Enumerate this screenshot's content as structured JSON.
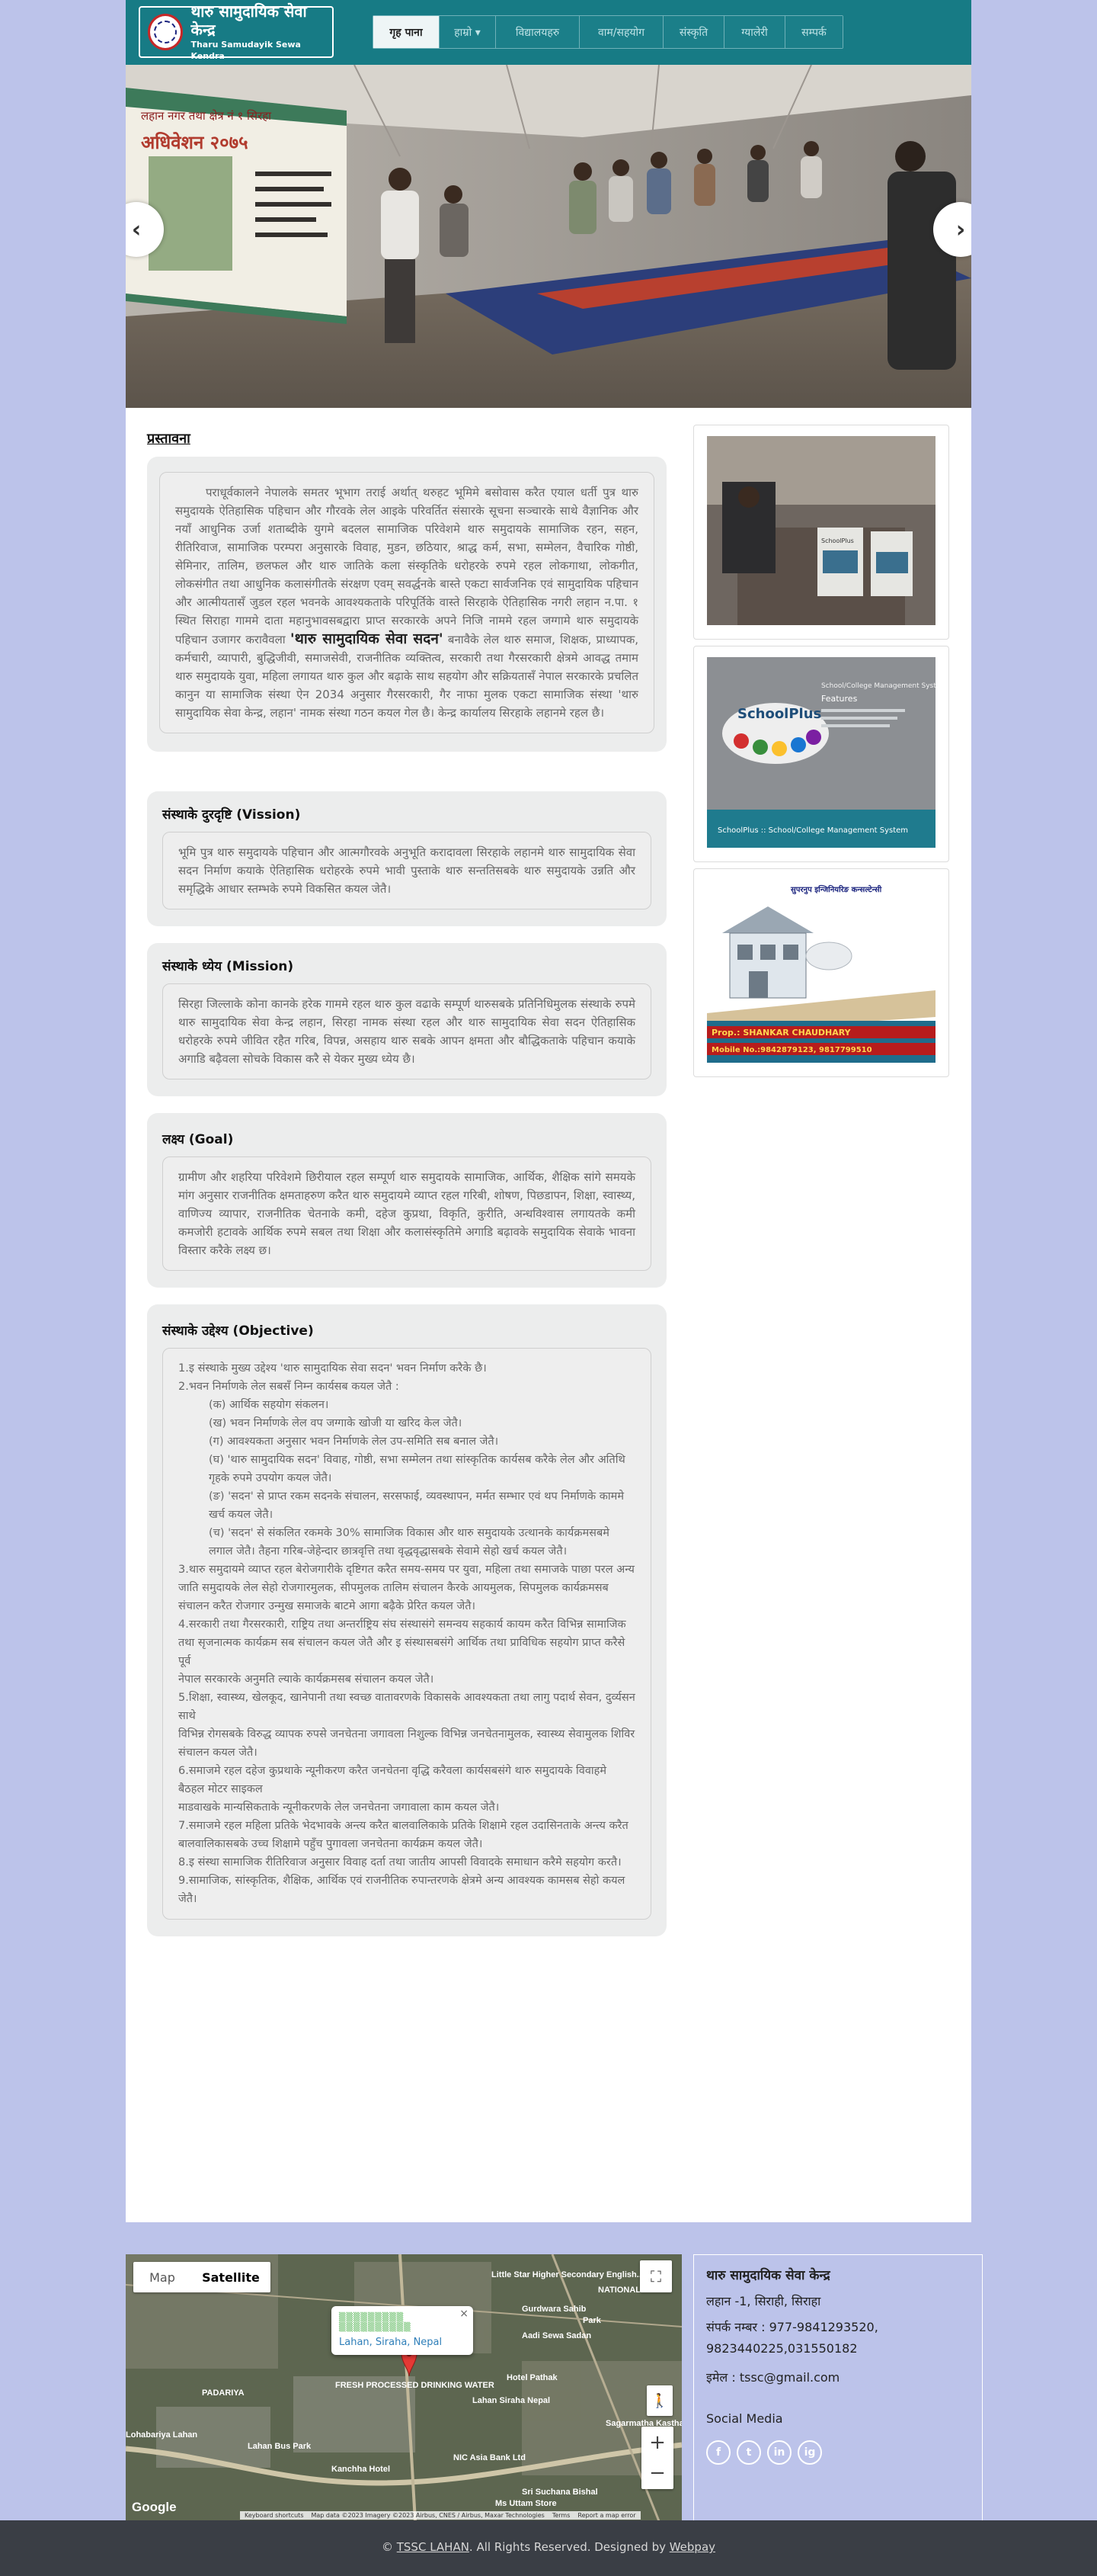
{
  "header": {
    "logo_np": "थारु सामुदायिक सेवा केन्द्र",
    "logo_en": "Tharu Samudayik Sewa Kendra",
    "nav": [
      "गृह पाना",
      "हाम्रो ▾",
      "विद्यालयहरु",
      "वाम/सहयोग",
      "संस्कृति",
      "ग्यालेरी",
      "सम्पर्क"
    ]
  },
  "slider": {
    "prev": "‹",
    "next": "›",
    "banner_line1": "लहान नगर तथा क्षेत्र नं १ सिरहा",
    "banner_line2": "अधिवेशन २०७५"
  },
  "intro": {
    "title": "प्रस्तावना",
    "p1": "पराधूर्वकालने नेपालके समतर भूभाग तराई अर्थात् थरुहट भूमिमे बसोवास करैत एयाल धर्ती पुत्र थारु समुदायके ऐतिहासिक पहिचान और गौरवके लेल आइके परिवर्तित संसारके सूचना सञ्चारके साथे वैज्ञानिक और नयाँ आधुनिक उर्जा शताब्दीके युगमे बदलल सामाजिक परिवेशमे थारु समुदायके सामाजिक रहन, सहन, रीतिरिवाज, सामाजिक परम्परा अनुसारके विवाह, मुडन, छठियार, श्राद्ध कर्म, सभा, सम्मेलन, वैचारिक गोष्ठी, सेमिनार, तालिम, छलफल और थारु जातिके कला संस्कृतिके धरोहरके रुपमे रहल लोकगाथा, लोकगीत, लोकसंगीत तथा आधुनिक कलासंगीतके संरक्षण एवम् सवर्द्धनके बास्ते एकटा सार्वजनिक एवं सामुदायिक पहिचान और आत्मीयतासँ जुडल रहल भवनके आवश्यकताके परिपूर्तिके वास्ते सिरहाके ऐतिहासिक नगरी लहान न.पा. १ स्थित सिराहा गाममे दाता महानुभावसबद्वारा प्राप्त सरकारके अपने निजि नाममे रहल जग्गामे थारु समुदायके पहिचान उजागर करावैवला",
    "highlight": "'थारु सामुदायिक सेवा सदन'",
    "p2": "बनावैके लेल थारु समाज, शिक्षक, प्राध्यापक, कर्मचारी, व्यापारी, बुद्धिजीवी, समाजसेवी, राजनीतिक व्यक्तित्व, सरकारी तथा गैरसरकारी क्षेत्रमे आवद्ध तमाम थारु समुदायके युवा, महिला लगायत थारु कुल और बढ़ाके साथ सहयोग और सक्रियतासँ नेपाल सरकारके प्रचलित कानुन या सामाजिक संस्था ऐन 2034 अनुसार गैरसरकारी, गैर नाफा मुलक एकटा सामाजिक संस्था 'थारु सामुदायिक सेवा केन्द्र, लहान' नामक संस्था गठन कयल गेल छै। केन्द्र कार्यालय सिरहाके लहानमे रहल छै।"
  },
  "vision": {
    "title": "संस्थाके दुरदृष्टि (Vission)",
    "text": "भूमि पुत्र थारु समुदायके पहिचान और आत्मगौरवके अनुभूति करादावला सिरहाके लहानमे थारु सामुदायिक सेवा सदन निर्माण कयाके ऐतिहासिक धरोहरके रुपमे भावी पुस्ताके थारु सन्ततिसबके थारु समुदायके उन्नति और समृद्धिके आधार स्तम्भके रुपमे विकसित कयल जेतै।"
  },
  "mission": {
    "title": "संस्थाके ध्येय (Mission)",
    "text": "सिरहा जिल्लाके कोना कानके हरेक गाममे रहल थारु कुल वढाके सम्पूर्ण थारुसबके प्रतिनिधिमुलक संस्थाके रुपमे थारु सामुदायिक सेवा केन्द्र लहान, सिरहा नामक संस्था रहल और थारु सामुदायिक सेवा सदन ऐतिहासिक धरोहरके रुपमे जीवित रहैत गरिब, विपन्न, असहाय थारु सबके आपन क्षमता और बौद्धिकताके पहिचान कयाके अगाडि बढ़ैवला सोचके विकास करै से येकर मुख्य ध्येय छै।"
  },
  "goal": {
    "title": "लक्ष्य (Goal)",
    "text": "ग्रामीण और शहरिया परिवेशमे छिरीयाल रहल सम्पूर्ण थारु समुदायके सामाजिक, आर्थिक, शैक्षिक सांगे समयके मांग अनुसार राजनीतिक क्षमताहरुण करैत थारु समुदायमे व्याप्त रहल गरिबी, शोषण, पिछडापन, शिक्षा, स्वास्थ्य, वाणिज्य व्यापार, राजनीतिक चेतनाके कमी, दहेज कुप्रथा, विकृति, कुरीति, अन्धविश्वास लगायतके कमी कमजोरी हटावके आर्थिक रुपमे सबल तथा शिक्षा और कलासंस्कृतिमे अगाडि बढ़ावके समुदायिक सेवाके भावना विस्तार करैके लक्ष्य छ।"
  },
  "objective": {
    "title": "संस्थाके उद्देश्य (Objective)",
    "items": [
      "1.इ संस्थाके मुख्य उद्देश्य 'थारु सामुदायिक सेवा सदन' भवन निर्माण करैके छै।",
      "2.भवन निर्माणके लेल सबसँ निम्न कार्यसब कयल जेतै :",
      "(क) आर्थिक सहयोग संकलन।",
      "(ख) भवन निर्माणके लेल वप जग्गाके खोजी या खरिद केल जेतै।",
      "(ग) आवश्यकता अनुसार भवन निर्माणके लेल उप-समिति सब बनाल जेतै।",
      "(घ) 'थारु सामुदायिक सदन' विवाह, गोष्ठी, सभा सम्मेलन तथा सांस्कृतिक कार्यसब करैके लेल और अतिथि गृहके रुपमे उपयोग कयल जेतै।",
      "(ङ) 'सदन' से प्राप्त रकम सदनके संचालन, सरसफाई, व्यवस्थापन, मर्मत सम्भार एवं थप निर्माणके काममे खर्च कयल जेतै।",
      "(च) 'सदन' से संकलित रकमके 30% सामाजिक विकास और थारु समुदायके उत्थानके कार्यक्रमसबमे लगाल जेतै। तैहना गरिब-जेहेन्दार छात्रवृत्ति तथा वृद्धवृद्धासबके सेवामे सेहो खर्च कयल जेतै।",
      "3.थारु समुदायमे व्याप्त रहल बेरोजगारीके दृष्टिगत करैत समय-समय पर युवा, महिला तथा समाजके पाछा परल अन्य जाति समुदायके लेल सेहो रोजगारमुलक, सीपमुलक तालिम संचालन कैरके आयमुलक, सिपमुलक कार्यक्रमसब संचालन करैत रोजगार उन्मुख समाजके बाटमे आगा बढ़ैके प्रेरित कयल जेतै।",
      "4.सरकारी तथा गैरसरकारी, राष्ट्रिय तथा अन्तर्राष्ट्रिय संघ संस्थासंगे समन्वय सहकार्य कायम करैत विभिन्न सामाजिक",
      "तथा सृजनात्मक कार्यक्रम सब संचालन कयल जेतै और इ संस्थासबसंगे आर्थिक तथा प्राविधिक सहयोग प्राप्त करैसे पूर्व",
      "नेपाल सरकारके अनुमति ल्याके कार्यक्रमसब संचालन कयल जेतै।",
      "5.शिक्षा, स्वास्थ्य, खेलकूद, खानेपानी तथा स्वच्छ वातावरणके विकासके आवश्यकता तथा लागु पदार्थ सेवन, दुर्व्यसन साथे",
      "विभिन्न रोगसबके विरुद्ध व्यापक रुपसे जनचेतना जगावला निशुल्क विभिन्न जनचेतनामुलक, स्वास्थ्य सेवामुलक शिविर",
      "संचालन कयल जेतै।",
      "6.समाजमे रहल दहेज कुप्रथाके न्यूनीकरण करैत जनचेतना वृद्धि करैवला कार्यसबसंगे थारु समुदायके विवाहमे बैठहल मोटर साइकल",
      "माडवाखके मान्यसिकताके न्यूनीकरणके लेल जनचेतना जगावाला काम कयल जेतै।",
      "7.समाजमे रहल महिला प्रतिके भेदभावके अन्त्य करैत बालवालिकाके प्रतिके शिक्षामे रहल उदासिनताके अन्त्य करैत",
      "बालवालिकासबके उच्च शिक्षामे पहुँच पुगावला जनचेतना कार्यक्रम कयल जेतै।",
      "8.इ संस्था सामाजिक रीतिरिवाज अनुसार विवाह दर्ता तथा जातीय आपसी विवादके समाधान करैमे सहयोग करतै।",
      "9.सामाजिक, सांस्कृतिक, शैक्षिक, आर्थिक एवं राजनीतिक रुपान्तरणके क्षेत्रमे अन्य आवश्यक कामसब सेहो कयल जेतै।"
    ]
  },
  "sidebar": {
    "ad1": {
      "label": "SchoolPlus"
    },
    "ad2": {
      "title": "SchoolPlus",
      "subtitle": "School/College Management System",
      "features": "Features",
      "footer": "SchoolPlus :: School/College Management System"
    },
    "ad3": {
      "top": "सुपरनुप इन्जिनियरिङ कन्सल्टेन्सी",
      "name": "Prop.: SHANKAR CHAUDHARY",
      "mobile": "Mobile No.:9842879123, 9817799510"
    }
  },
  "map": {
    "type_map": "Map",
    "type_sat": "Satellite",
    "place": "Lahan, Siraha, Nepal",
    "place_blur": "▒▒▒▒▒▒▒▒▒ ▒▒▒▒▒▒▒▒▒▒",
    "labels": [
      "Little Star Higher Secondary English...",
      "NATIONAL ACA...",
      "Gurdwara Sahib",
      "Park",
      "Aadi Sewa Sadan",
      "PADARIYA",
      "FRESH PROCESSED DRINKING WATER",
      "Hotel Pathak",
      "Lahan Siraha Nepal",
      "Sagarmatha Kastha Udhyog",
      "Lohabariya Lahan",
      "Lahan Bus Park",
      "NIC Asia Bank Ltd",
      "Kanchha Hotel",
      "Sri Suchana Bishal",
      "Ms Uttam Store"
    ],
    "footer_items": [
      "Keyboard shortcuts",
      "Map data ©2023 Imagery ©2023 Airbus, CNES / Airbus, Maxar Technologies",
      "Terms",
      "Report a map error"
    ],
    "google": "Google",
    "zoom_in": "+",
    "zoom_out": "−"
  },
  "contact": {
    "title": "थारु सामुदायिक सेवा केन्द्र",
    "address": "लहान -1, सिराही, सिराहा",
    "phone_label": "संपर्क नम्बर : 977-9841293520,",
    "phone2": "9823440225,031550182",
    "email": "इमेल : tssc@gmail.com",
    "social_title": "Social Media",
    "social_icons": [
      "f",
      "t",
      "in",
      "ig"
    ]
  },
  "footer": {
    "prefix": "© ",
    "brand": "TSSC LAHAN",
    "middle": ". All Rights Reserved. Designed by ",
    "designer": "Webpay"
  }
}
